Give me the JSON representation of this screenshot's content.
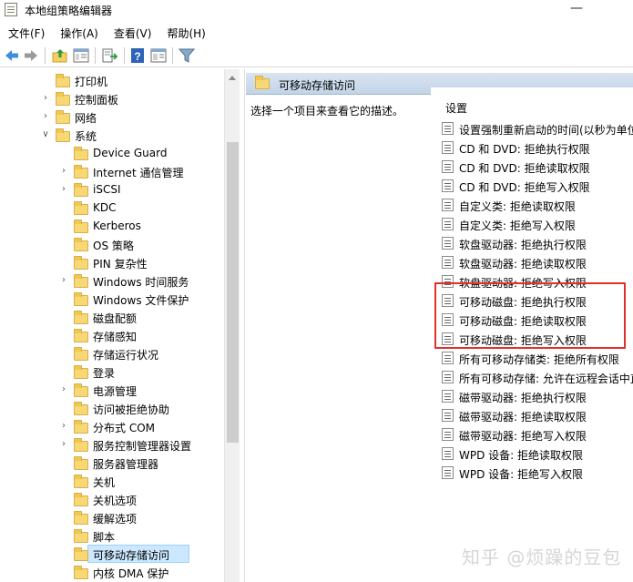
{
  "window": {
    "title": "本地组策略编辑器",
    "minimize_glyph": "—"
  },
  "menubar": {
    "items": [
      "文件(F)",
      "操作(A)",
      "查看(V)",
      "帮助(H)"
    ]
  },
  "toolbar": {
    "buttons": [
      "back-icon",
      "forward-icon",
      "up-folder-icon",
      "show-hide-tree-icon",
      "export-list-icon",
      "help-icon",
      "properties-icon",
      "filter-icon"
    ]
  },
  "tree": {
    "items": [
      {
        "label": "打印机",
        "expandable": false,
        "expanded": false,
        "level": 2
      },
      {
        "label": "控制面板",
        "expandable": true,
        "expanded": false,
        "level": 2
      },
      {
        "label": "网络",
        "expandable": true,
        "expanded": false,
        "level": 2
      },
      {
        "label": "系统",
        "expandable": true,
        "expanded": true,
        "level": 2
      },
      {
        "label": "Device Guard",
        "expandable": false,
        "expanded": false,
        "level": 3
      },
      {
        "label": "Internet 通信管理",
        "expandable": true,
        "expanded": false,
        "level": 3
      },
      {
        "label": "iSCSI",
        "expandable": true,
        "expanded": false,
        "level": 3
      },
      {
        "label": "KDC",
        "expandable": false,
        "expanded": false,
        "level": 3
      },
      {
        "label": "Kerberos",
        "expandable": false,
        "expanded": false,
        "level": 3
      },
      {
        "label": "OS 策略",
        "expandable": false,
        "expanded": false,
        "level": 3
      },
      {
        "label": "PIN 复杂性",
        "expandable": false,
        "expanded": false,
        "level": 3
      },
      {
        "label": "Windows 时间服务",
        "expandable": true,
        "expanded": false,
        "level": 3
      },
      {
        "label": "Windows 文件保护",
        "expandable": false,
        "expanded": false,
        "level": 3
      },
      {
        "label": "磁盘配额",
        "expandable": false,
        "expanded": false,
        "level": 3
      },
      {
        "label": "存储感知",
        "expandable": false,
        "expanded": false,
        "level": 3
      },
      {
        "label": "存储运行状况",
        "expandable": false,
        "expanded": false,
        "level": 3
      },
      {
        "label": "登录",
        "expandable": false,
        "expanded": false,
        "level": 3
      },
      {
        "label": "电源管理",
        "expandable": true,
        "expanded": false,
        "level": 3
      },
      {
        "label": "访问被拒绝协助",
        "expandable": false,
        "expanded": false,
        "level": 3
      },
      {
        "label": "分布式 COM",
        "expandable": true,
        "expanded": false,
        "level": 3
      },
      {
        "label": "服务控制管理器设置",
        "expandable": true,
        "expanded": false,
        "level": 3
      },
      {
        "label": "服务器管理器",
        "expandable": false,
        "expanded": false,
        "level": 3
      },
      {
        "label": "关机",
        "expandable": false,
        "expanded": false,
        "level": 3
      },
      {
        "label": "关机选项",
        "expandable": false,
        "expanded": false,
        "level": 3
      },
      {
        "label": "缓解选项",
        "expandable": false,
        "expanded": false,
        "level": 3
      },
      {
        "label": "脚本",
        "expandable": false,
        "expanded": false,
        "level": 3
      },
      {
        "label": "可移动存储访问",
        "expandable": false,
        "expanded": false,
        "level": 3,
        "selected": true
      },
      {
        "label": "内核 DMA 保护",
        "expandable": false,
        "expanded": false,
        "level": 3
      }
    ]
  },
  "right_pane": {
    "header_title": "可移动存储访问",
    "description": "选择一个项目来查看它的描述。",
    "column_header": "设置",
    "settings": [
      "设置强制重新启动的时间(以秒为单位)",
      "CD 和 DVD: 拒绝执行权限",
      "CD 和 DVD: 拒绝读取权限",
      "CD 和 DVD: 拒绝写入权限",
      "自定义类: 拒绝读取权限",
      "自定义类: 拒绝写入权限",
      "软盘驱动器: 拒绝执行权限",
      "软盘驱动器: 拒绝读取权限",
      "软盘驱动器: 拒绝写入权限",
      "可移动磁盘: 拒绝执行权限",
      "可移动磁盘: 拒绝读取权限",
      "可移动磁盘: 拒绝写入权限",
      "所有可移动存储类: 拒绝所有权限",
      "所有可移动存储: 允许在远程会话中直接访问",
      "磁带驱动器: 拒绝执行权限",
      "磁带驱动器: 拒绝读取权限",
      "磁带驱动器: 拒绝写入权限",
      "WPD 设备: 拒绝读取权限",
      "WPD 设备: 拒绝写入权限"
    ]
  },
  "watermark": "知乎 @烦躁的豆包",
  "colors": {
    "highlight_box": "#e0302d",
    "selection": "#cce8ff",
    "header_gradient": "#c3d4e8"
  }
}
